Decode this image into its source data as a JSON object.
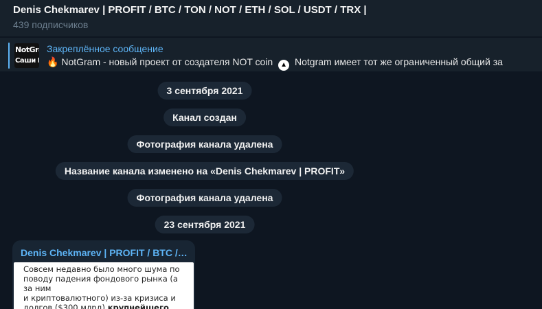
{
  "header": {
    "title": "Denis Chekmarev | PROFIT / BTC / TON / NOT / ETH / SOL / USDT / TRX |",
    "subscribers": "439 подписчиков"
  },
  "pinned": {
    "label": "Закреплённое сообщение",
    "thumb_line1": "NotGra",
    "thumb_line2": "Саши Ni",
    "emoji": "🔥",
    "text_part1": " NotGram  - новый проект от создателя NOT coin ",
    "tri_icon": "▲",
    "text_part2": " Notgram имеет тот же ограниченный общий за"
  },
  "service_messages": [
    "3 сентября 2021",
    "Канал создан",
    "Фотография канала удалена",
    "Название канала изменено на «Denis Chekmarev | PROFIT»",
    "Фотография канала удалена",
    "23 сентября 2021"
  ],
  "post": {
    "author": "Denis Chekmarev | PROFIT / BTC /…",
    "image_text_line1": "Совсем недавно было много шума по",
    "image_text_line2": "поводу падения фондового рынка (а за ним",
    "image_text_line3": "и криптовалютного) из-за кризиса и",
    "image_text_line4": "долгов ($300 млрд) ",
    "image_text_bold": "крупнейшего"
  },
  "colors": {
    "background": "#0e1621",
    "panel": "#17212b",
    "accent": "#5eb5f7",
    "service_bubble": "#1c2836"
  }
}
